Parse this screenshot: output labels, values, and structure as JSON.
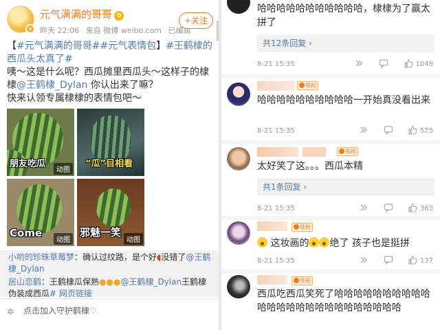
{
  "post": {
    "username": "元气满满的哥哥",
    "time": "昨天 22:06",
    "source": "来自 微博 weibo.com",
    "edited": "已编辑",
    "follow_label": "+关注",
    "text": {
      "bracket_open": "【",
      "tag1": "#元气满满的哥哥#",
      "tag2": "#元气表情包",
      "bracket_close": "】",
      "tag3": "#王鹤棣的西瓜头太真了#",
      "line2": "咦～这是什么呢？西瓜摊里西瓜头～这样子的棣棣",
      "mention": "@王鹤棣_Dylan",
      "line3": " 你认出来了嘛？",
      "line4": "快来认领专属棣棣的表情包吧～"
    },
    "images": [
      {
        "caption": "朋友吃瓜",
        "gif": "动图"
      },
      {
        "caption": "“瓜”目相看",
        "gif": ""
      },
      {
        "caption": "Come",
        "gif": "动图"
      },
      {
        "caption": "邪魅一笑",
        "gif": "动图"
      }
    ],
    "replies": [
      {
        "user": "小哟的珍珠草莓梦",
        "text": "：确认过纹路，是个好",
        "text2": "没错了",
        "mention": "@王鹤棣_Dylan"
      },
      {
        "user": "居山恋鹤",
        "text": "：王鹤棣瓜保熟",
        "mention": "@王鹤棣_Dylan",
        "text2": "王鹤棣伪装成西瓜",
        "link": "# 网页链接"
      }
    ],
    "guard_text": "点击加入守护鹤棣♡"
  },
  "comments": [
    {
      "text": "哈哈哈哈哈哈哈哈哈哈哈，棣棣为了赢太拼了",
      "replies": "共12条回复",
      "time": "8-21 15:35",
      "likes": "1048",
      "fan": ""
    },
    {
      "text": "哈哈哈哈哈哈哈哈哈哈一开始真没看出来",
      "replies": "",
      "time": "8-21 15:35",
      "likes": "525",
      "fan": "铁粉"
    },
    {
      "text": "太好笑了这。。。西瓜本精",
      "replies": "共1条回复",
      "time": "8-21 15:35",
      "likes": "363",
      "fan": "铁粉"
    },
    {
      "text": "这妆画的",
      "text2": "绝了 孩子也是挺拼",
      "replies": "",
      "time": "8-21 15:35",
      "likes": "137",
      "fan": "铁粉"
    },
    {
      "text": "西瓜吃西瓜笑死了哈哈哈哈哈哈哈哈哈哈哈哈哈哈哈哈哈哈哈哈哈哈哈哈哈",
      "replies": "",
      "time": "",
      "likes": "",
      "fan": "铁粉"
    }
  ],
  "colors": {
    "accent": "#f27b1c",
    "link": "#507daf",
    "text": "#333333",
    "muted": "#999999"
  },
  "icons": [
    "vip-badge-icon",
    "comment-icon",
    "like-icon",
    "share-icon",
    "emoji-icon",
    "heart-icon"
  ]
}
